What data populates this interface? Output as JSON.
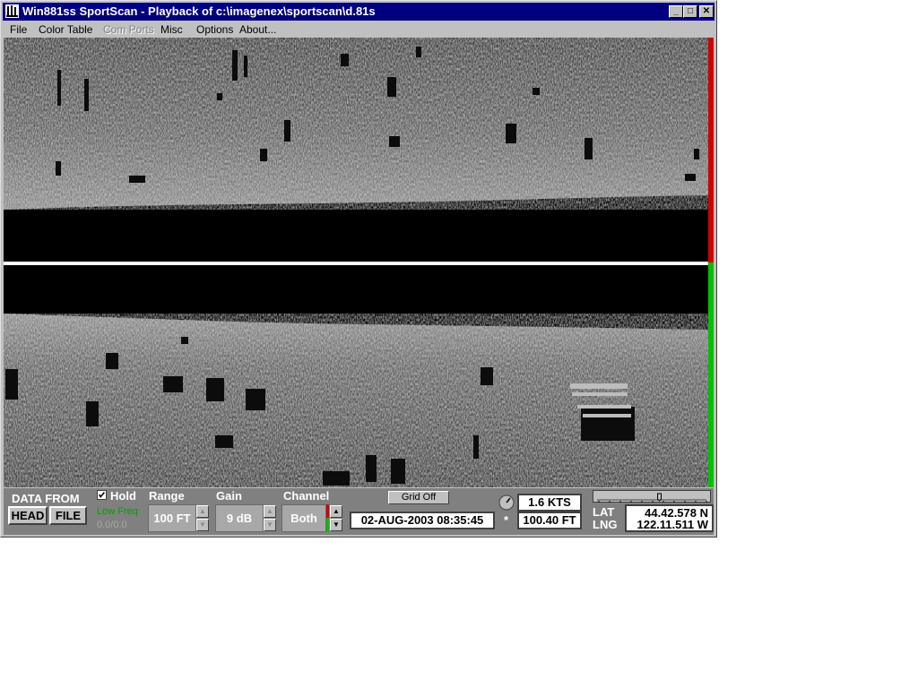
{
  "window": {
    "title": "Win881ss SportScan - Playback of c:\\imagenex\\sportscan\\d.81s",
    "controls": {
      "minimize": "_",
      "maximize": "□",
      "close": "✕"
    }
  },
  "menu": [
    {
      "label": "File",
      "enabled": true
    },
    {
      "label": "Color Table",
      "enabled": true
    },
    {
      "label": "Com Ports",
      "enabled": false
    },
    {
      "label": "Misc",
      "enabled": true
    },
    {
      "label": "Options",
      "enabled": true
    },
    {
      "label": "About...",
      "enabled": true
    }
  ],
  "colors": {
    "port_channel": "#d40000",
    "starboard_channel": "#00c000",
    "titlebar": "#000080",
    "panel": "#808080"
  },
  "controls": {
    "data_from_label": "DATA FROM",
    "head_button": "HEAD",
    "file_button": "FILE",
    "hold_label": "Hold",
    "hold_checked": true,
    "freq_label": "Low Freq",
    "freq_value": "0.0/0.0",
    "range_label": "Range",
    "range_value": "100 FT",
    "gain_label": "Gain",
    "gain_value": "9 dB",
    "channel_label": "Channel",
    "channel_value": "Both",
    "grid_button": "Grid Off",
    "datetime": "02-AUG-2003  08:35:45",
    "speed": "1.6 KTS",
    "depth": "100.40 FT",
    "depth_marker": "*",
    "lat_label": "LAT",
    "lng_label": "LNG",
    "lat_value": "44.42.578 N",
    "lng_value": "122.11.511 W",
    "playback_position": 0.57
  },
  "icons": {
    "app": "app-icon",
    "compass": "compass-icon",
    "up": "arrow-up-icon",
    "down": "arrow-down-icon"
  }
}
